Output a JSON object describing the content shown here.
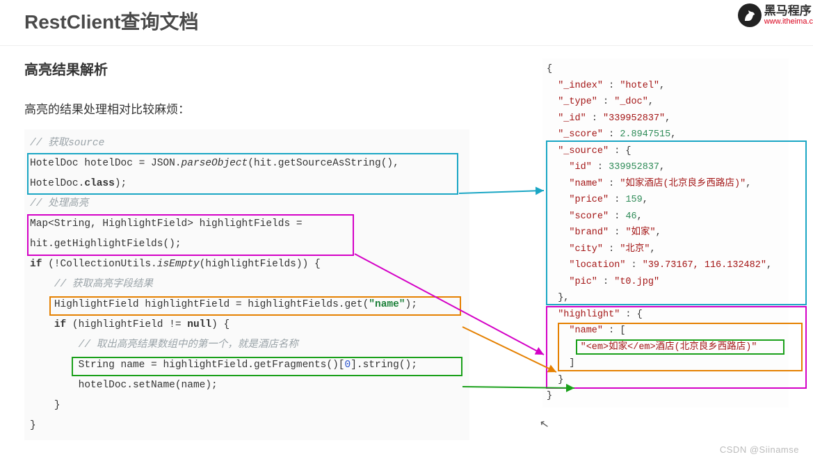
{
  "header": {
    "title": "RestClient查询文档",
    "brand_cn": "黑马程序",
    "brand_url": "www.itheima.c"
  },
  "left": {
    "subheading": "高亮结果解析",
    "intro": "高亮的结果处理相对比较麻烦：",
    "code": {
      "l1": "// 获取source",
      "l2a": "HotelDoc hotelDoc = JSON.",
      "l2b": "parseObject",
      "l2c": "(hit.getSourceAsString(),",
      "l3a": "HotelDoc.",
      "l3b": "class",
      "l3c": ");",
      "l4": "// 处理高亮",
      "l5": "Map<String, HighlightField> highlightFields =",
      "l6": "hit.getHighlightFields();",
      "l7a": "if",
      "l7b": " (!CollectionUtils.",
      "l7c": "isEmpty",
      "l7d": "(highlightFields)) {",
      "l8": "// 获取高亮字段结果",
      "l9a": "HighlightField highlightField = highlightFields.get(",
      "l9b": "\"name\"",
      "l9c": ");",
      "l10a": "if",
      "l10b": " (highlightField != ",
      "l10c": "null",
      "l10d": ") {",
      "l11": "// 取出高亮结果数组中的第一个，就是酒店名称",
      "l12a": "String name = highlightField.getFragments()[",
      "l12b": "0",
      "l12c": "].string();",
      "l13": "hotelDoc.setName(name);",
      "l14": "}",
      "l15": "}"
    }
  },
  "right": {
    "json": {
      "open": "{",
      "index_k": "\"_index\"",
      "index_v": "\"hotel\"",
      "type_k": "\"_type\"",
      "type_v": "\"_doc\"",
      "id_k": "\"_id\"",
      "id_v": "\"339952837\"",
      "score_k": "\"_score\"",
      "score_v": "2.8947515",
      "source_k": "\"_source\"",
      "s_id_k": "\"id\"",
      "s_id_v": "339952837",
      "s_name_k": "\"name\"",
      "s_name_v": "\"如家酒店(北京良乡西路店)\"",
      "s_price_k": "\"price\"",
      "s_price_v": "159",
      "s_score_k": "\"score\"",
      "s_score_v": "46",
      "s_brand_k": "\"brand\"",
      "s_brand_v": "\"如家\"",
      "s_city_k": "\"city\"",
      "s_city_v": "\"北京\"",
      "s_loc_k": "\"location\"",
      "s_loc_v": "\"39.73167, 116.132482\"",
      "s_pic_k": "\"pic\"",
      "s_pic_v": "\"t0.jpg\"",
      "hl_k": "\"highlight\"",
      "hl_name_k": "\"name\"",
      "hl_val": "\"<em>如家</em>酒店(北京良乡西路店)\"",
      "close": "}"
    }
  },
  "watermark": "CSDN @Siinamse"
}
